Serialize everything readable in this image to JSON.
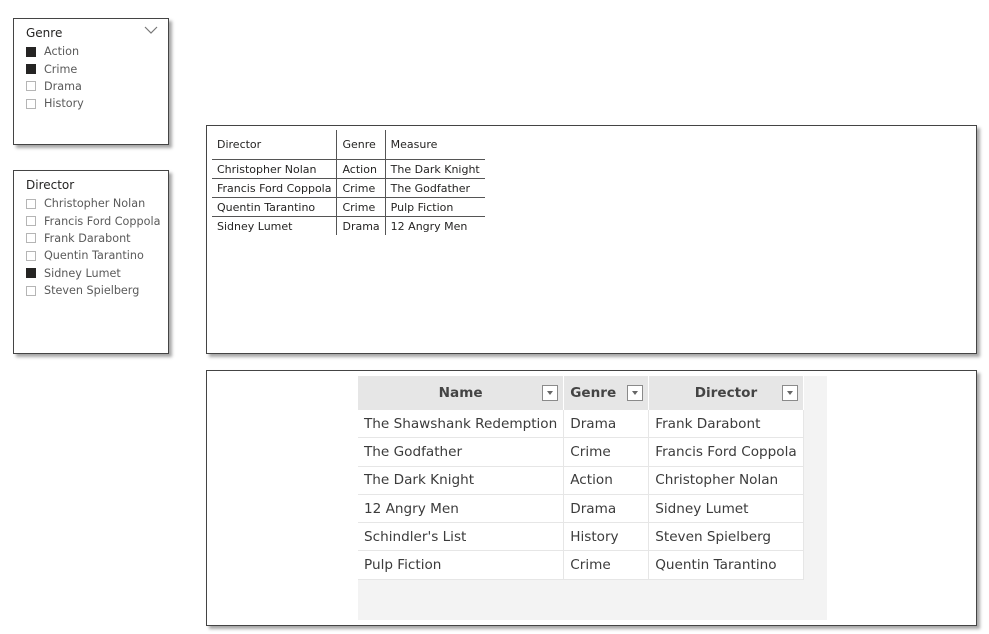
{
  "genre_slicer": {
    "title": "Genre",
    "items": [
      {
        "label": "Action",
        "checked": true
      },
      {
        "label": "Crime",
        "checked": true
      },
      {
        "label": "Drama",
        "checked": false
      },
      {
        "label": "History",
        "checked": false
      }
    ]
  },
  "director_slicer": {
    "title": "Director",
    "items": [
      {
        "label": "Christopher Nolan",
        "checked": false
      },
      {
        "label": "Francis Ford Coppola",
        "checked": false
      },
      {
        "label": "Frank Darabont",
        "checked": false
      },
      {
        "label": "Quentin Tarantino",
        "checked": false
      },
      {
        "label": "Sidney Lumet",
        "checked": true
      },
      {
        "label": "Steven Spielberg",
        "checked": false
      }
    ]
  },
  "table_visual": {
    "headers": [
      "Director",
      "Genre",
      "Measure"
    ],
    "rows": [
      [
        "Christopher Nolan",
        "Action",
        "The Dark Knight"
      ],
      [
        "Francis Ford Coppola",
        "Crime",
        "The Godfather"
      ],
      [
        "Quentin Tarantino",
        "Crime",
        "Pulp Fiction"
      ],
      [
        "Sidney Lumet",
        "Drama",
        "12 Angry Men"
      ]
    ]
  },
  "data_table": {
    "headers": [
      "Name",
      "Genre",
      "Director"
    ],
    "rows": [
      [
        "The Shawshank Redemption",
        "Drama",
        "Frank Darabont"
      ],
      [
        "The Godfather",
        "Crime",
        "Francis Ford Coppola"
      ],
      [
        "The Dark Knight",
        "Action",
        "Christopher Nolan"
      ],
      [
        "12 Angry Men",
        "Drama",
        "Sidney Lumet"
      ],
      [
        "Schindler's List",
        "History",
        "Steven Spielberg"
      ],
      [
        "Pulp Fiction",
        "Crime",
        "Quentin Tarantino"
      ]
    ]
  },
  "colors": {
    "checked": "#252423",
    "border": "#444444",
    "table_header_bg": "#e6e6e6"
  }
}
